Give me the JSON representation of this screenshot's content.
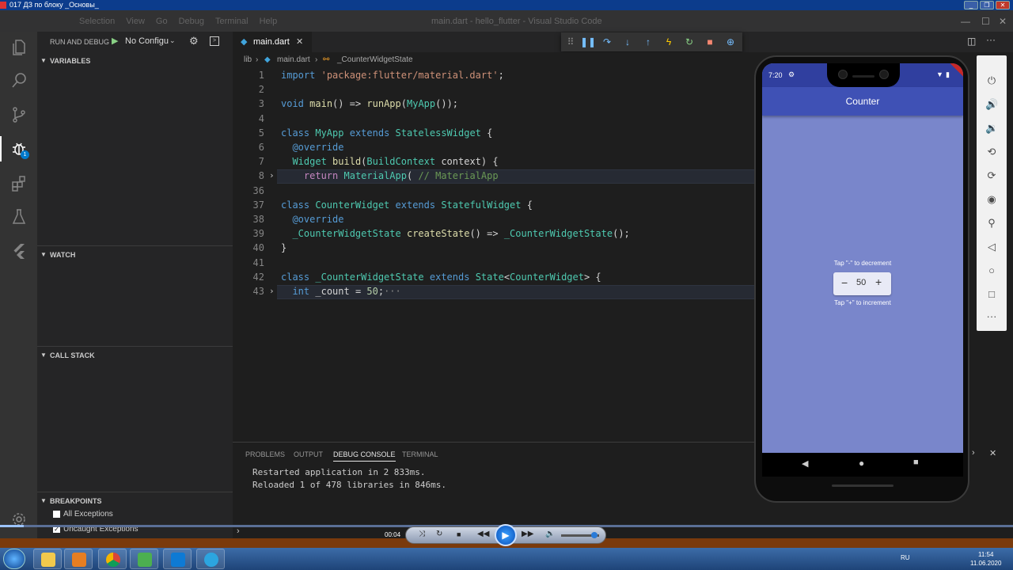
{
  "player": {
    "title": "017 ДЗ по блоку _Основы_",
    "controls": {
      "min": "_",
      "restore": "❐",
      "close": "✕"
    },
    "time": "00:04"
  },
  "vscode": {
    "menu": [
      "Selection",
      "View",
      "Go",
      "Debug",
      "Terminal",
      "Help"
    ],
    "window_title": "main.dart - hello_flutter - Visual Studio Code"
  },
  "sidebar": {
    "run_label": "RUN AND DEBUG",
    "config": "No Configu",
    "sections": {
      "variables": "VARIABLES",
      "watch": "WATCH",
      "call_stack": "CALL STACK",
      "breakpoints": "BREAKPOINTS"
    },
    "breakpoints": [
      {
        "label": "All Exceptions",
        "checked": false
      },
      {
        "label": "Uncaught Exceptions",
        "checked": true
      }
    ],
    "debug_badge": "1"
  },
  "editor": {
    "tab": "main.dart",
    "breadcrumb": [
      "lib",
      "main.dart",
      "_CounterWidgetState"
    ],
    "lines": [
      {
        "n": "1",
        "html": "<span class='kw'>import</span> <span class='str'>'package:flutter/material.dart'</span>;"
      },
      {
        "n": "2",
        "html": ""
      },
      {
        "n": "3",
        "html": "<span class='kw'>void</span> <span class='fn'>main</span>() => <span class='fn'>runApp</span>(<span class='ty'>MyApp</span>());"
      },
      {
        "n": "4",
        "html": ""
      },
      {
        "n": "5",
        "html": "<span class='kw'>class</span> <span class='ty'>MyApp</span> <span class='kw'>extends</span> <span class='ty'>StatelessWidget</span> {"
      },
      {
        "n": "6",
        "html": "  <span class='an'>@override</span>"
      },
      {
        "n": "7",
        "html": "  <span class='ty'>Widget</span> <span class='fn'>build</span>(<span class='ty'>BuildContext</span> context) {"
      },
      {
        "n": "8",
        "html": "    <span class='kw2'>return</span> <span class='ty'>MaterialApp</span>( <span class='cm'>// MaterialApp</span>",
        "fold": true,
        "hl": true
      },
      {
        "n": "36",
        "html": ""
      },
      {
        "n": "37",
        "html": "<span class='kw'>class</span> <span class='ty'>CounterWidget</span> <span class='kw'>extends</span> <span class='ty'>StatefulWidget</span> {"
      },
      {
        "n": "38",
        "html": "  <span class='an'>@override</span>"
      },
      {
        "n": "39",
        "html": "  <span class='ty'>_CounterWidgetState</span> <span class='fn'>createState</span>() => <span class='ty'>_CounterWidgetState</span>();"
      },
      {
        "n": "40",
        "html": "}"
      },
      {
        "n": "41",
        "html": ""
      },
      {
        "n": "42",
        "html": "<span class='kw'>class</span> <span class='ty'>_CounterWidgetState</span> <span class='kw'>extends</span> <span class='ty'>State</span>&lt;<span class='ty'>CounterWidget</span>&gt; {"
      },
      {
        "n": "43",
        "html": "  <span class='kw'>int</span> _count = <span class='num'>50</span>;<span style='color:#858585'>···</span>",
        "fold": true,
        "hl": true
      }
    ]
  },
  "panel": {
    "tabs": [
      "PROBLEMS",
      "OUTPUT",
      "DEBUG CONSOLE",
      "TERMINAL"
    ],
    "active_tab": "DEBUG CONSOLE",
    "console": [
      "Restarted application in 2 833ms.",
      "Reloaded 1 of 478 libraries in 846ms."
    ]
  },
  "emulator": {
    "time": "7:20",
    "app_title": "Counter",
    "hint_decrement": "Tap \"-\" to decrement",
    "hint_increment": "Tap \"+\" to increment",
    "minus": "−",
    "count": "50",
    "plus": "+"
  },
  "taskbar": {
    "lang": "RU",
    "time": "11:54",
    "date": "11.06.2020"
  },
  "colors": {
    "accent": "#007acc",
    "appbar": "#3f51b5",
    "screen_bg": "#7986cb"
  }
}
